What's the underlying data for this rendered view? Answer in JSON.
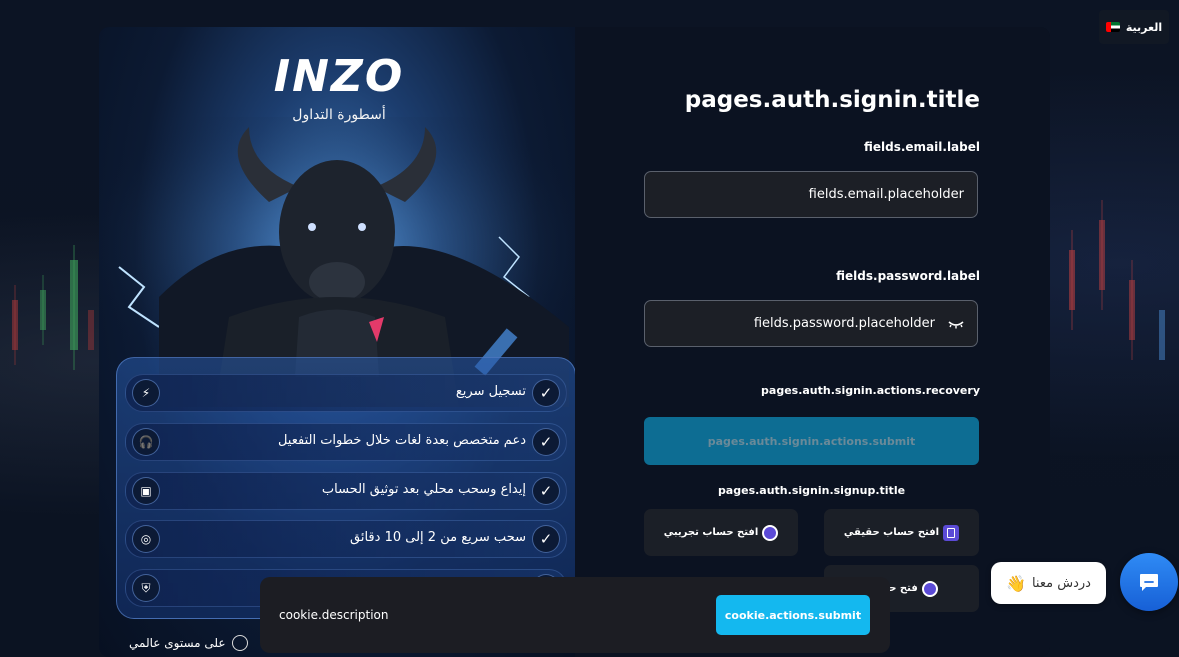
{
  "language": {
    "label": "العربية",
    "flag_icon": "uae-flag-icon"
  },
  "promo": {
    "logo_text": "INZO",
    "logo_tagline": "أسطورة التداول",
    "features": [
      {
        "icon": "lightning-icon",
        "text": "تسجيل سريع"
      },
      {
        "icon": "headset-icon",
        "text": "دعم متخصص بعدة لغات خلال خطوات التفعيل"
      },
      {
        "icon": "wallet-icon",
        "text": "إيداع وسحب محلي بعد توثيق الحساب"
      },
      {
        "icon": "coin-stack-icon",
        "text": "سحب سريع من 2 إلى 10 دقائق"
      },
      {
        "icon": "shield-icon",
        "text": ""
      }
    ],
    "bottom_text": "على مستوى عالمي"
  },
  "form": {
    "title": "pages.auth.signin.title",
    "email_label": "fields.email.label",
    "email_placeholder": "fields.email.placeholder",
    "password_label": "fields.password.label",
    "password_placeholder": "fields.password.placeholder",
    "recovery_link": "pages.auth.signin.actions.recovery",
    "submit_label": "pages.auth.signin.actions.submit",
    "signup_title": "pages.auth.signin.signup.title",
    "real_account_label": "افتح حساب حقيقي",
    "demo_account_label": "افتح حساب تجريبي",
    "third_account_label": "فتح حساب"
  },
  "cookie": {
    "description": "cookie.description",
    "submit_label": "cookie.actions.submit"
  },
  "chat": {
    "bubble_text": "دردش معنا",
    "wave_icon": "👋"
  },
  "colors": {
    "submit_bg": "#0d6d93",
    "cookie_btn": "#14b8ef",
    "chat_btn": "#2f8bf5"
  }
}
